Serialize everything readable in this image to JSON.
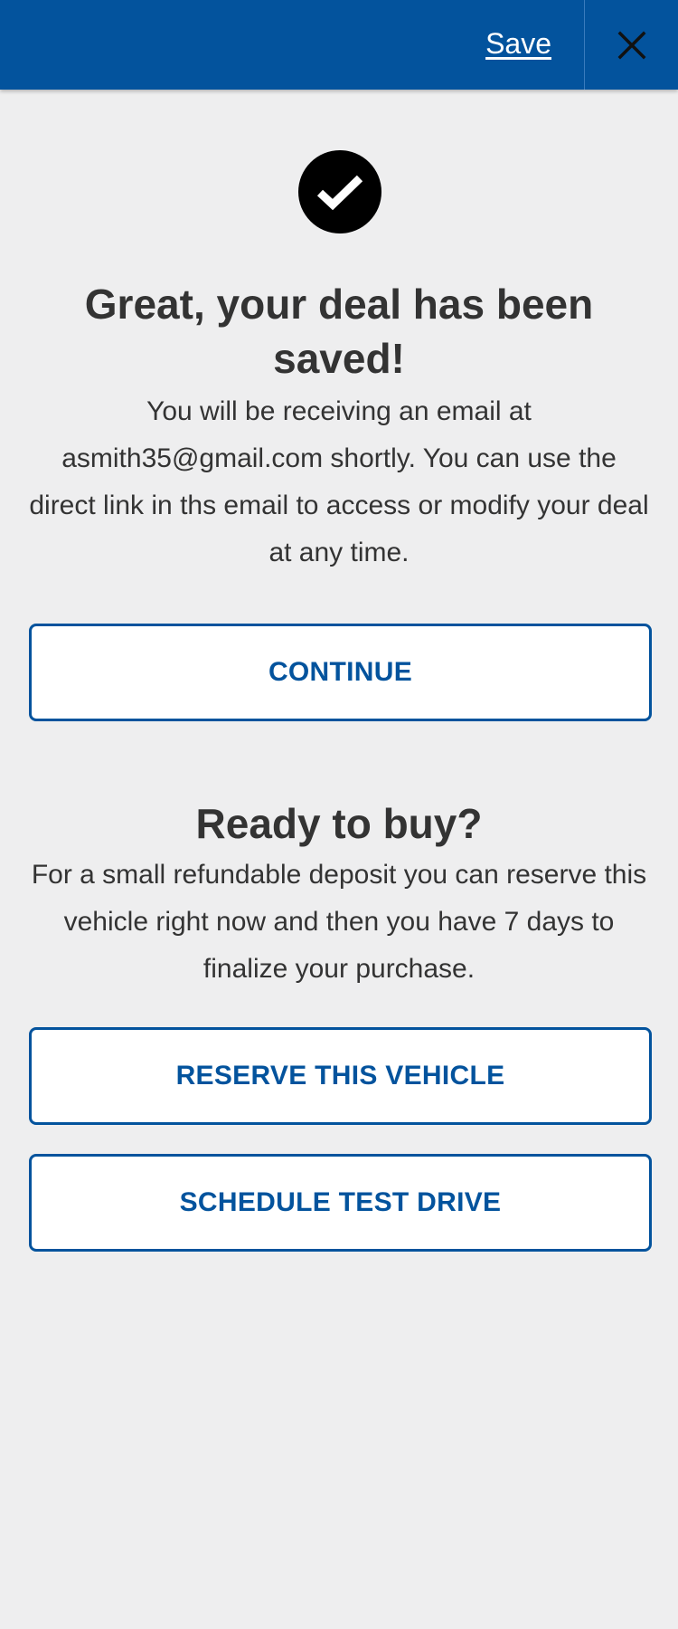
{
  "header": {
    "save_label": "Save",
    "close_icon": "close-icon",
    "background_color": "#03539d"
  },
  "confirmation": {
    "icon": "check-circle-icon",
    "title": "Great, your deal has been saved!",
    "message": "You will be receiving an email at asmith35@gmail.com shortly. You can use the direct link in ths email to access or modify your deal at any time.",
    "continue_label": "CONTINUE"
  },
  "ready_section": {
    "title": "Ready to buy?",
    "message": "For a small refundable deposit you can reserve this vehicle right now and then you have 7 days to finalize your purchase.",
    "reserve_label": "RESERVE THIS VEHICLE",
    "schedule_label": "SCHEDULE TEST DRIVE"
  },
  "colors": {
    "accent": "#03539d",
    "page_background": "#eeeeef",
    "text": "#333333"
  }
}
